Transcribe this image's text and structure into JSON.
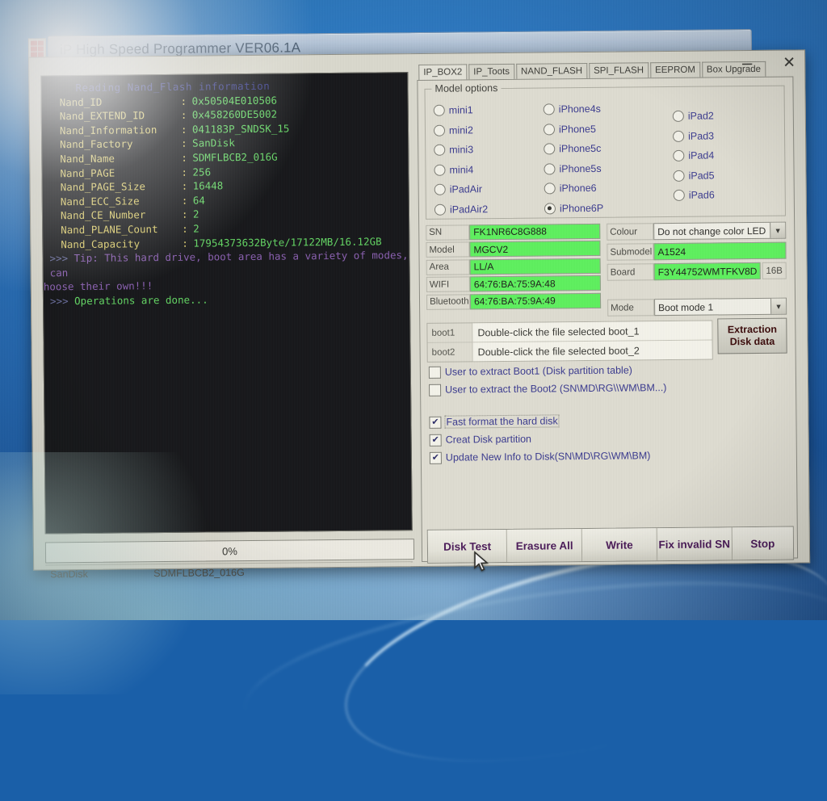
{
  "window": {
    "title": "iP High Speed Programmer VER06.1A",
    "icon": "app-grid-icon",
    "minimize": "–",
    "close": "✕"
  },
  "console": {
    "header": "Reading Nand_Flash information",
    "rows": [
      {
        "key": "Nand_ID",
        "colon": ":",
        "value": "0x50504E010506"
      },
      {
        "key": "Nand_EXTEND_ID",
        "colon": ":",
        "value": "0x458260DE5002"
      },
      {
        "key": "Nand_Information",
        "colon": ":",
        "value": "041183P_SNDSK_15"
      },
      {
        "key": "Nand_Factory",
        "colon": ":",
        "value": "SanDisk"
      },
      {
        "key": "Nand_Name",
        "colon": ":",
        "value": "SDMFLBCB2_016G"
      },
      {
        "key": "Nand_PAGE",
        "colon": ":",
        "value": "256"
      },
      {
        "key": "Nand_PAGE_Size",
        "colon": ":",
        "value": "16448"
      },
      {
        "key": "Nand_ECC_Size",
        "colon": ":",
        "value": "64"
      },
      {
        "key": "Nand_CE_Number",
        "colon": ":",
        "value": "2"
      },
      {
        "key": "Nand_PLANE_Count",
        "colon": ":",
        "value": "2"
      },
      {
        "key": "Nand_Capacity",
        "colon": ":",
        "value": "17954373632Byte/17122MB/16.12GB"
      }
    ],
    "tip_prefix": ">>>",
    "tip_line1": "Tip: This hard drive, boot area has a variety of modes, can",
    "tip_line2": "hoose their own!!!",
    "done_prefix": ">>>",
    "done_line": "Operations are done..."
  },
  "progress": {
    "percent_label": "0%",
    "value": 0
  },
  "statusbar": {
    "factory": "SanDisk",
    "part": "SDMFLBCB2_016G"
  },
  "tabs": [
    {
      "label": "IP_BOX2",
      "active": true
    },
    {
      "label": "IP_Toots",
      "active": false
    },
    {
      "label": "NAND_FLASH",
      "active": false
    },
    {
      "label": "SPI_FLASH",
      "active": false
    },
    {
      "label": "EEPROM",
      "active": false
    },
    {
      "label": "Box Upgrade",
      "active": false
    }
  ],
  "model_options": {
    "legend": "Model options",
    "col1": [
      {
        "label": "mini1",
        "selected": false
      },
      {
        "label": "mini2",
        "selected": false
      },
      {
        "label": "mini3",
        "selected": false
      },
      {
        "label": "mini4",
        "selected": false
      },
      {
        "label": "iPadAir",
        "selected": false
      },
      {
        "label": "iPadAir2",
        "selected": false
      }
    ],
    "col2": [
      {
        "label": "iPhone4s",
        "selected": false
      },
      {
        "label": "iPhone5",
        "selected": false
      },
      {
        "label": "iPhone5c",
        "selected": false
      },
      {
        "label": "iPhone5s",
        "selected": false
      },
      {
        "label": "iPhone6",
        "selected": false
      },
      {
        "label": "iPhone6P",
        "selected": true
      }
    ],
    "col3": [
      {
        "label": "iPad2",
        "selected": false
      },
      {
        "label": "iPad3",
        "selected": false
      },
      {
        "label": "iPad4",
        "selected": false
      },
      {
        "label": "iPad5",
        "selected": false
      },
      {
        "label": "iPad6",
        "selected": false
      }
    ]
  },
  "fields_left": [
    {
      "label": "SN",
      "value": "FK1NR6C8G888"
    },
    {
      "label": "Model",
      "value": "MGCV2"
    },
    {
      "label": "Area",
      "value": "LL/A"
    },
    {
      "label": "WIFI",
      "value": "64:76:BA:75:9A:48"
    },
    {
      "label": "Bluetooth",
      "value": "64:76:BA:75:9A:49"
    }
  ],
  "fields_right": {
    "colour_label": "Colour",
    "colour_value": "Do not change color LED",
    "submodel_label": "Submodel",
    "submodel_value": "A1524",
    "board_label": "Board",
    "board_value": "F3Y44752WMTFKV8D",
    "board_suffix": "16B",
    "mode_label": "Mode",
    "mode_value": "Boot mode 1",
    "dropdown_arrow": "▼"
  },
  "boot": {
    "row1_label": "boot1",
    "row1_value": "Double-click the file selected boot_1",
    "row2_label": "boot2",
    "row2_value": "Double-click the file selected boot_2",
    "extract_line1": "Extraction",
    "extract_line2": "Disk data"
  },
  "checkboxes": [
    {
      "label": "User to extract Boot1 (Disk partition table)",
      "checked": false,
      "focus": false
    },
    {
      "label": "User to extract the Boot2 (SN\\MD\\RG\\\\WM\\BM...)",
      "checked": false,
      "focus": false
    },
    {
      "label": "Fast format the hard disk",
      "checked": true,
      "focus": true
    },
    {
      "label": "Creat Disk partition",
      "checked": true,
      "focus": false
    },
    {
      "label": "Update New Info to Disk(SN\\MD\\RG\\WM\\BM)",
      "checked": true,
      "focus": false
    }
  ],
  "check_mark": "✔",
  "action_buttons": [
    {
      "label": "Disk Test"
    },
    {
      "label": "Erasure All"
    },
    {
      "label": "Write"
    },
    {
      "label": "Fix invalid SN"
    },
    {
      "label": "Stop"
    }
  ],
  "colors": {
    "field_green": "#5ef05e",
    "console_bg": "#16171a",
    "console_key": "#d8c96a",
    "console_value": "#63d463",
    "console_tip": "#8a5fb0",
    "desktop_blue": "#1f5fa8",
    "button_text": "#4a1a58",
    "radio_label": "#3b3b8f"
  }
}
